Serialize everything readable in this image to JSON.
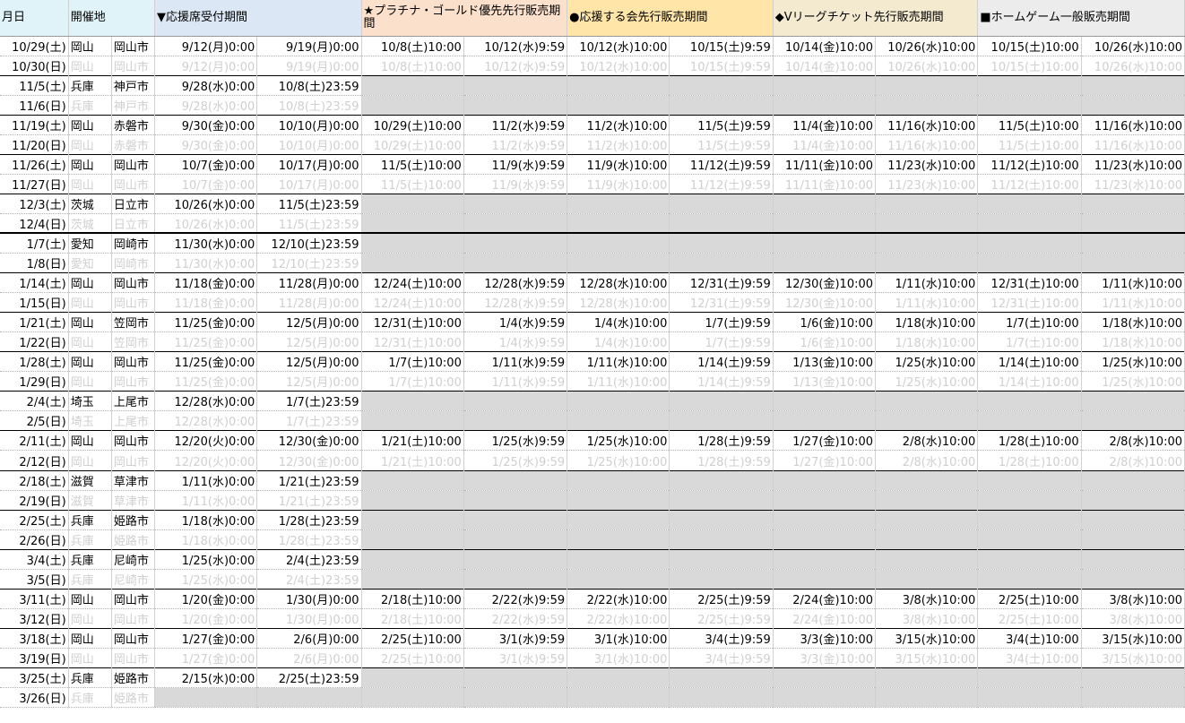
{
  "headers": {
    "day": "月日",
    "venue": "開催地",
    "support": "▼応援席受付期間",
    "platinum": "★プラチナ・ゴールド優先先行販売期間",
    "club": "●応援する会先行販売期間",
    "vleague": "◆Vリーグチケット先行販売期間",
    "general": "■ホームゲーム一般販売期間"
  },
  "rows": [
    {
      "day": "10/29(土)",
      "pref": "岡山",
      "city": "岡山市",
      "s1": "9/12(月)0:00",
      "s2": "9/19(月)0:00",
      "p1": "10/8(土)10:00",
      "p2": "10/12(水)9:59",
      "k1": "10/12(水)10:00",
      "k2": "10/15(土)9:59",
      "v1": "10/14(金)10:00",
      "v2": "10/26(水)10:00",
      "g1": "10/15(土)10:00",
      "g2": "10/26(水)10:00"
    },
    {
      "day": "10/30(日)",
      "pref": "岡山",
      "city": "岡山市",
      "s1": "9/12(月)0:00",
      "s2": "9/19(月)0:00",
      "p1": "10/8(土)10:00",
      "p2": "10/12(水)9:59",
      "k1": "10/12(水)10:00",
      "k2": "10/15(土)9:59",
      "v1": "10/14(金)10:00",
      "v2": "10/26(水)10:00",
      "g1": "10/15(土)10:00",
      "g2": "10/26(水)10:00"
    },
    {
      "day": "11/5(土)",
      "pref": "兵庫",
      "city": "神戸市",
      "s1": "9/28(水)0:00",
      "s2": "10/8(土)23:59",
      "p1": "",
      "p2": "",
      "k1": "",
      "k2": "",
      "v1": "",
      "v2": "",
      "g1": "",
      "g2": ""
    },
    {
      "day": "11/6(日)",
      "pref": "兵庫",
      "city": "神戸市",
      "s1": "9/28(水)0:00",
      "s2": "10/8(土)23:59",
      "p1": "",
      "p2": "",
      "k1": "",
      "k2": "",
      "v1": "",
      "v2": "",
      "g1": "",
      "g2": ""
    },
    {
      "day": "11/19(土)",
      "pref": "岡山",
      "city": "赤磐市",
      "s1": "9/30(金)0:00",
      "s2": "10/10(月)0:00",
      "p1": "10/29(土)10:00",
      "p2": "11/2(水)9:59",
      "k1": "11/2(水)10:00",
      "k2": "11/5(土)9:59",
      "v1": "11/4(金)10:00",
      "v2": "11/16(水)10:00",
      "g1": "11/5(土)10:00",
      "g2": "11/16(水)10:00"
    },
    {
      "day": "11/20(日)",
      "pref": "岡山",
      "city": "赤磐市",
      "s1": "9/30(金)0:00",
      "s2": "10/10(月)0:00",
      "p1": "10/29(土)10:00",
      "p2": "11/2(水)9:59",
      "k1": "11/2(水)10:00",
      "k2": "11/5(土)9:59",
      "v1": "11/4(金)10:00",
      "v2": "11/16(水)10:00",
      "g1": "11/5(土)10:00",
      "g2": "11/16(水)10:00"
    },
    {
      "day": "11/26(土)",
      "pref": "岡山",
      "city": "岡山市",
      "s1": "10/7(金)0:00",
      "s2": "10/17(月)0:00",
      "p1": "11/5(土)10:00",
      "p2": "11/9(水)9:59",
      "k1": "11/9(水)10:00",
      "k2": "11/12(土)9:59",
      "v1": "11/11(金)10:00",
      "v2": "11/23(水)10:00",
      "g1": "11/12(土)10:00",
      "g2": "11/23(水)10:00"
    },
    {
      "day": "11/27(日)",
      "pref": "岡山",
      "city": "岡山市",
      "s1": "10/7(金)0:00",
      "s2": "10/17(月)0:00",
      "p1": "11/5(土)10:00",
      "p2": "11/9(水)9:59",
      "k1": "11/9(水)10:00",
      "k2": "11/12(土)9:59",
      "v1": "11/11(金)10:00",
      "v2": "11/23(水)10:00",
      "g1": "11/12(土)10:00",
      "g2": "11/23(水)10:00"
    },
    {
      "day": "12/3(土)",
      "pref": "茨城",
      "city": "日立市",
      "s1": "10/26(水)0:00",
      "s2": "11/5(土)23:59",
      "p1": "",
      "p2": "",
      "k1": "",
      "k2": "",
      "v1": "",
      "v2": "",
      "g1": "",
      "g2": ""
    },
    {
      "day": "12/4(日)",
      "pref": "茨城",
      "city": "日立市",
      "s1": "10/26(水)0:00",
      "s2": "11/5(土)23:59",
      "p1": "",
      "p2": "",
      "k1": "",
      "k2": "",
      "v1": "",
      "v2": "",
      "g1": "",
      "g2": ""
    },
    {
      "day": "1/7(土)",
      "pref": "愛知",
      "city": "岡崎市",
      "s1": "11/30(水)0:00",
      "s2": "12/10(土)23:59",
      "p1": "",
      "p2": "",
      "k1": "",
      "k2": "",
      "v1": "",
      "v2": "",
      "g1": "",
      "g2": ""
    },
    {
      "day": "1/8(日)",
      "pref": "愛知",
      "city": "岡崎市",
      "s1": "11/30(水)0:00",
      "s2": "12/10(土)23:59",
      "p1": "",
      "p2": "",
      "k1": "",
      "k2": "",
      "v1": "",
      "v2": "",
      "g1": "",
      "g2": ""
    },
    {
      "day": "1/14(土)",
      "pref": "岡山",
      "city": "岡山市",
      "s1": "11/18(金)0:00",
      "s2": "11/28(月)0:00",
      "p1": "12/24(土)10:00",
      "p2": "12/28(水)9:59",
      "k1": "12/28(水)10:00",
      "k2": "12/31(土)9:59",
      "v1": "12/30(金)10:00",
      "v2": "1/11(水)10:00",
      "g1": "12/31(土)10:00",
      "g2": "1/11(水)10:00"
    },
    {
      "day": "1/15(日)",
      "pref": "岡山",
      "city": "岡山市",
      "s1": "11/18(金)0:00",
      "s2": "11/28(月)0:00",
      "p1": "12/24(土)10:00",
      "p2": "12/28(水)9:59",
      "k1": "12/28(水)10:00",
      "k2": "12/31(土)9:59",
      "v1": "12/30(金)10:00",
      "v2": "1/11(水)10:00",
      "g1": "12/31(土)10:00",
      "g2": "1/11(水)10:00"
    },
    {
      "day": "1/21(土)",
      "pref": "岡山",
      "city": "笠岡市",
      "s1": "11/25(金)0:00",
      "s2": "12/5(月)0:00",
      "p1": "12/31(土)10:00",
      "p2": "1/4(水)9:59",
      "k1": "1/4(水)10:00",
      "k2": "1/7(土)9:59",
      "v1": "1/6(金)10:00",
      "v2": "1/18(水)10:00",
      "g1": "1/7(土)10:00",
      "g2": "1/18(水)10:00"
    },
    {
      "day": "1/22(日)",
      "pref": "岡山",
      "city": "笠岡市",
      "s1": "11/25(金)0:00",
      "s2": "12/5(月)0:00",
      "p1": "12/31(土)10:00",
      "p2": "1/4(水)9:59",
      "k1": "1/4(水)10:00",
      "k2": "1/7(土)9:59",
      "v1": "1/6(金)10:00",
      "v2": "1/18(水)10:00",
      "g1": "1/7(土)10:00",
      "g2": "1/18(水)10:00"
    },
    {
      "day": "1/28(土)",
      "pref": "岡山",
      "city": "岡山市",
      "s1": "11/25(金)0:00",
      "s2": "12/5(月)0:00",
      "p1": "1/7(土)10:00",
      "p2": "1/11(水)9:59",
      "k1": "1/11(水)10:00",
      "k2": "1/14(土)9:59",
      "v1": "1/13(金)10:00",
      "v2": "1/25(水)10:00",
      "g1": "1/14(土)10:00",
      "g2": "1/25(水)10:00"
    },
    {
      "day": "1/29(日)",
      "pref": "岡山",
      "city": "岡山市",
      "s1": "11/25(金)0:00",
      "s2": "12/5(月)0:00",
      "p1": "1/7(土)10:00",
      "p2": "1/11(水)9:59",
      "k1": "1/11(水)10:00",
      "k2": "1/14(土)9:59",
      "v1": "1/13(金)10:00",
      "v2": "1/25(水)10:00",
      "g1": "1/14(土)10:00",
      "g2": "1/25(水)10:00"
    },
    {
      "day": "2/4(土)",
      "pref": "埼玉",
      "city": "上尾市",
      "s1": "12/28(水)0:00",
      "s2": "1/7(土)23:59",
      "p1": "",
      "p2": "",
      "k1": "",
      "k2": "",
      "v1": "",
      "v2": "",
      "g1": "",
      "g2": ""
    },
    {
      "day": "2/5(日)",
      "pref": "埼玉",
      "city": "上尾市",
      "s1": "12/28(水)0:00",
      "s2": "1/7(土)23:59",
      "p1": "",
      "p2": "",
      "k1": "",
      "k2": "",
      "v1": "",
      "v2": "",
      "g1": "",
      "g2": ""
    },
    {
      "day": "2/11(土)",
      "pref": "岡山",
      "city": "岡山市",
      "s1": "12/20(火)0:00",
      "s2": "12/30(金)0:00",
      "p1": "1/21(土)10:00",
      "p2": "1/25(水)9:59",
      "k1": "1/25(水)10:00",
      "k2": "1/28(土)9:59",
      "v1": "1/27(金)10:00",
      "v2": "2/8(水)10:00",
      "g1": "1/28(土)10:00",
      "g2": "2/8(水)10:00"
    },
    {
      "day": "2/12(日)",
      "pref": "岡山",
      "city": "岡山市",
      "s1": "12/20(火)0:00",
      "s2": "12/30(金)0:00",
      "p1": "1/21(土)10:00",
      "p2": "1/25(水)9:59",
      "k1": "1/25(水)10:00",
      "k2": "1/28(土)9:59",
      "v1": "1/27(金)10:00",
      "v2": "2/8(水)10:00",
      "g1": "1/28(土)10:00",
      "g2": "2/8(水)10:00"
    },
    {
      "day": "2/18(土)",
      "pref": "滋賀",
      "city": "草津市",
      "s1": "1/11(水)0:00",
      "s2": "1/21(土)23:59",
      "p1": "",
      "p2": "",
      "k1": "",
      "k2": "",
      "v1": "",
      "v2": "",
      "g1": "",
      "g2": ""
    },
    {
      "day": "2/19(日)",
      "pref": "滋賀",
      "city": "草津市",
      "s1": "1/11(水)0:00",
      "s2": "1/21(土)23:59",
      "p1": "",
      "p2": "",
      "k1": "",
      "k2": "",
      "v1": "",
      "v2": "",
      "g1": "",
      "g2": ""
    },
    {
      "day": "2/25(土)",
      "pref": "兵庫",
      "city": "姫路市",
      "s1": "1/18(水)0:00",
      "s2": "1/28(土)23:59",
      "p1": "",
      "p2": "",
      "k1": "",
      "k2": "",
      "v1": "",
      "v2": "",
      "g1": "",
      "g2": ""
    },
    {
      "day": "2/26(日)",
      "pref": "兵庫",
      "city": "姫路市",
      "s1": "1/18(水)0:00",
      "s2": "1/28(土)23:59",
      "p1": "",
      "p2": "",
      "k1": "",
      "k2": "",
      "v1": "",
      "v2": "",
      "g1": "",
      "g2": ""
    },
    {
      "day": "3/4(土)",
      "pref": "兵庫",
      "city": "尼崎市",
      "s1": "1/25(水)0:00",
      "s2": "2/4(土)23:59",
      "p1": "",
      "p2": "",
      "k1": "",
      "k2": "",
      "v1": "",
      "v2": "",
      "g1": "",
      "g2": ""
    },
    {
      "day": "3/5(日)",
      "pref": "兵庫",
      "city": "尼崎市",
      "s1": "1/25(水)0:00",
      "s2": "2/4(土)23:59",
      "p1": "",
      "p2": "",
      "k1": "",
      "k2": "",
      "v1": "",
      "v2": "",
      "g1": "",
      "g2": ""
    },
    {
      "day": "3/11(土)",
      "pref": "岡山",
      "city": "岡山市",
      "s1": "1/20(金)0:00",
      "s2": "1/30(月)0:00",
      "p1": "2/18(土)10:00",
      "p2": "2/22(水)9:59",
      "k1": "2/22(水)10:00",
      "k2": "2/25(土)9:59",
      "v1": "2/24(金)10:00",
      "v2": "3/8(水)10:00",
      "g1": "2/25(土)10:00",
      "g2": "3/8(水)10:00"
    },
    {
      "day": "3/12(日)",
      "pref": "岡山",
      "city": "岡山市",
      "s1": "1/20(金)0:00",
      "s2": "1/30(月)0:00",
      "p1": "2/18(土)10:00",
      "p2": "2/22(水)9:59",
      "k1": "2/22(水)10:00",
      "k2": "2/25(土)9:59",
      "v1": "2/24(金)10:00",
      "v2": "3/8(水)10:00",
      "g1": "2/25(土)10:00",
      "g2": "3/8(水)10:00"
    },
    {
      "day": "3/18(土)",
      "pref": "岡山",
      "city": "岡山市",
      "s1": "1/27(金)0:00",
      "s2": "2/6(月)0:00",
      "p1": "2/25(土)10:00",
      "p2": "3/1(水)9:59",
      "k1": "3/1(水)10:00",
      "k2": "3/4(土)9:59",
      "v1": "3/3(金)10:00",
      "v2": "3/15(水)10:00",
      "g1": "3/4(土)10:00",
      "g2": "3/15(水)10:00"
    },
    {
      "day": "3/19(日)",
      "pref": "岡山",
      "city": "岡山市",
      "s1": "1/27(金)0:00",
      "s2": "2/6(月)0:00",
      "p1": "2/25(土)10:00",
      "p2": "3/1(水)9:59",
      "k1": "3/1(水)10:00",
      "k2": "3/4(土)9:59",
      "v1": "3/3(金)10:00",
      "v2": "3/15(水)10:00",
      "g1": "3/4(土)10:00",
      "g2": "3/15(水)10:00"
    },
    {
      "day": "3/25(土)",
      "pref": "兵庫",
      "city": "姫路市",
      "s1": "2/15(水)0:00",
      "s2": "2/25(土)23:59",
      "p1": "",
      "p2": "",
      "k1": "",
      "k2": "",
      "v1": "",
      "v2": "",
      "g1": "",
      "g2": ""
    },
    {
      "day": "3/26(日)",
      "pref": "兵庫",
      "city": "姫路市",
      "s1": "",
      "s2": "",
      "p1": "",
      "p2": "",
      "k1": "",
      "k2": "",
      "v1": "",
      "v2": "",
      "g1": "",
      "g2": ""
    }
  ]
}
